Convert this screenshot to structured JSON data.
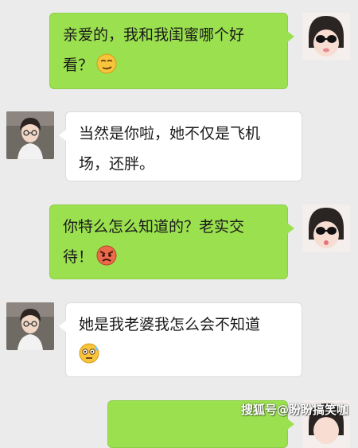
{
  "messages": [
    {
      "side": "out",
      "line1": "亲爱的，我和我闺蜜哪个好",
      "line2": "看？",
      "emoji": "smirk-emoji"
    },
    {
      "side": "in",
      "line1": "当然是你啦，她不仅是飞机",
      "line2": "场，还胖。"
    },
    {
      "side": "out",
      "line1": "你特么怎么知道的？老实交",
      "line2": "待！",
      "emoji": "angry-emoji"
    },
    {
      "side": "in",
      "line1": "她是我老婆我怎么会不知道",
      "line2": "",
      "emoji": "sweat-emoji"
    },
    {
      "side": "out",
      "line1": "",
      "line2": ""
    }
  ],
  "watermark": "搜狐号@盼盼搞笑咖",
  "colors": {
    "background": "#ebebeb",
    "outgoing_bubble": "#9be14f",
    "incoming_bubble": "#ffffff"
  }
}
